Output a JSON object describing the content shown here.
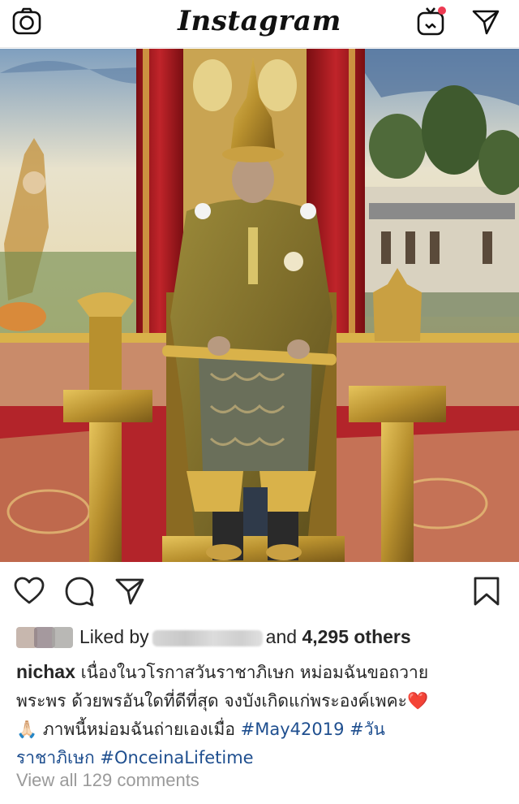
{
  "topbar": {
    "logo_text": "Instagram",
    "camera_icon": "camera-icon",
    "igtv_icon": "igtv-icon",
    "direct_icon": "paper-plane-icon"
  },
  "post": {
    "photo_alt": "ceremony-photo",
    "actions": {
      "like_icon": "heart-outline-icon",
      "comment_icon": "comment-bubble-icon",
      "share_icon": "paper-plane-icon",
      "save_icon": "bookmark-icon"
    },
    "likes": {
      "prefix": "Liked by",
      "middle": "and",
      "count": "4,295 others"
    },
    "caption": {
      "username": "nichax",
      "line1": "เนื่องในวโรกาสวันราชาภิเษก หม่อมฉันขอถวาย",
      "line2": "พระพร ด้วยพรอันใดที่ดีที่สุด จงบังเกิดแก่พระองค์เพคะ",
      "heart": "❤️",
      "hands": "🙏🏻",
      "line3": "ภาพนี้หม่อมฉันถ่ายเองเมื่อ",
      "tag1": "#May42019",
      "tag2": "#วัน",
      "tag2_cont": "ราชาภิเษก",
      "tag3": "#OnceinaLifetime"
    },
    "view_comments": "View all 129 comments"
  },
  "colors": {
    "hashtag": "#1f4f8f",
    "muted": "#9a9a9a",
    "heart": "#e0202a"
  }
}
